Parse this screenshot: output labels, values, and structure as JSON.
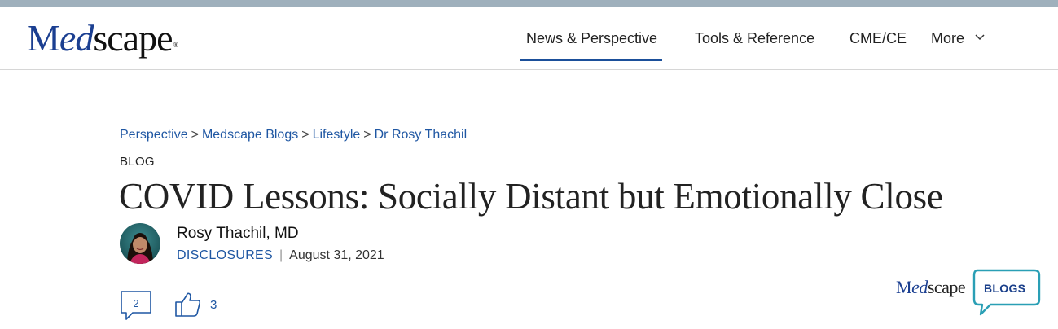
{
  "brand": {
    "logo_m": "M",
    "logo_ed": "ed",
    "logo_rest": "scape",
    "logo_reg": "®"
  },
  "nav": {
    "items": [
      {
        "label": "News & Perspective",
        "active": true
      },
      {
        "label": "Tools & Reference",
        "active": false
      },
      {
        "label": "CME/CE",
        "active": false
      },
      {
        "label": "More",
        "active": false
      }
    ]
  },
  "breadcrumb": [
    "Perspective",
    "Medscape Blogs",
    "Lifestyle",
    "Dr Rosy Thachil"
  ],
  "breadcrumb_sep": ">",
  "article": {
    "section": "BLOG",
    "title": "COVID Lessons: Socially Distant but Emotionally Close",
    "author": "Rosy Thachil, MD",
    "disclosures": "DISCLOSURES",
    "separator": "|",
    "date": "August 31, 2021"
  },
  "engagement": {
    "comments_count": "2",
    "likes_count": "3"
  },
  "blogs_logo": {
    "m": "M",
    "ed": "ed",
    "rest": "scape",
    "tag": "BLOGS"
  },
  "colors": {
    "brand_blue": "#1b3f91",
    "link_blue": "#1f57a3",
    "teal": "#2a9fb5",
    "top_bar": "#9fb0bc"
  }
}
